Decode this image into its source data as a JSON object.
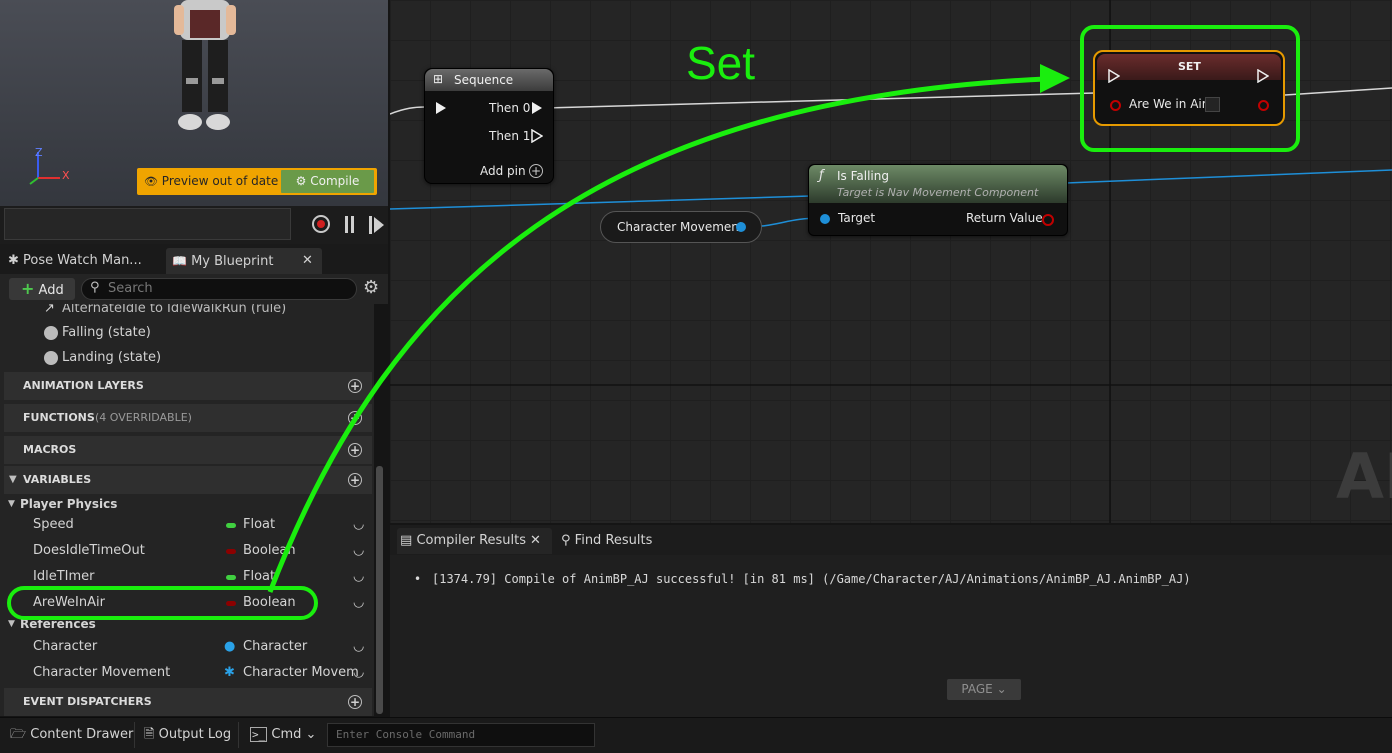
{
  "viewport": {
    "preview_label": "Preview out of date",
    "compile_label": "Compile",
    "axis_z": "Z",
    "axis_x": "X"
  },
  "panel_tabs": {
    "pose_watch": "Pose Watch Man...",
    "my_blueprint": "My Blueprint"
  },
  "toolbar": {
    "add_label": "Add",
    "search_placeholder": "Search"
  },
  "tree_items": {
    "rule_partial": "AlternateIdle to IdleWalkRun (rule)",
    "falling": "Falling (state)",
    "landing": "Landing (state)"
  },
  "sections": {
    "animation_layers": "ANIMATION LAYERS",
    "functions": "FUNCTIONS",
    "functions_note": "(4 OVERRIDABLE)",
    "macros": "MACROS",
    "variables": "VARIABLES",
    "event_dispatchers": "EVENT DISPATCHERS"
  },
  "categories": {
    "player_physics": "Player Physics",
    "references": "References"
  },
  "variables": [
    {
      "name": "Speed",
      "type": "Float",
      "color": "#40d040"
    },
    {
      "name": "DoesIdleTimeOut",
      "type": "Boolean",
      "color": "#8c0000"
    },
    {
      "name": "IdleTImer",
      "type": "Float",
      "color": "#40d040"
    },
    {
      "name": "AreWeInAir",
      "type": "Boolean",
      "color": "#8c0000"
    }
  ],
  "references": [
    {
      "name": "Character",
      "type": "Character"
    },
    {
      "name": "Character Movement",
      "type": "Character Movem"
    }
  ],
  "graph": {
    "sequence_title": "Sequence",
    "then0": "Then 0",
    "then1": "Then 1",
    "add_pin": "Add pin",
    "set_title": "SET",
    "set_pin": "Are We in Air",
    "is_falling_title": "Is Falling",
    "is_falling_subtitle": "Target is Nav Movement Component",
    "target_pin": "Target",
    "return_pin": "Return Value",
    "char_movement": "Character Movement",
    "watermark": "AN"
  },
  "annotation": {
    "label": "Set",
    "color": "#1aee0e"
  },
  "results": {
    "compiler_tab": "Compiler Results",
    "find_tab": "Find Results",
    "log": "[1374.79] Compile of AnimBP_AJ successful! [in 81 ms] (/Game/Character/AJ/Animations/AnimBP_AJ.AnimBP_AJ)",
    "page_button": "PAGE"
  },
  "statusbar": {
    "content_drawer": "Content Drawer",
    "output_log": "Output Log",
    "cmd": "Cmd",
    "console_placeholder": "Enter Console Command"
  }
}
